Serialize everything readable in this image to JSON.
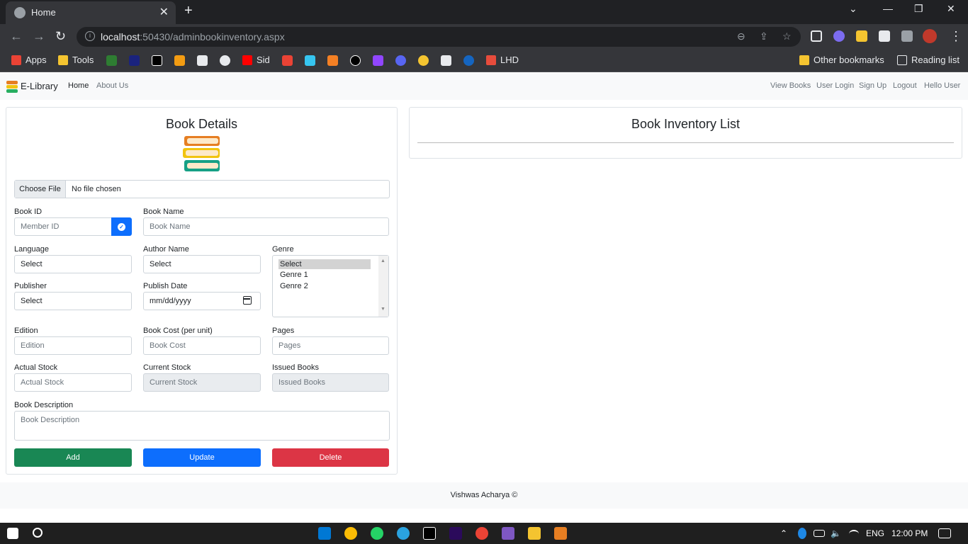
{
  "browser": {
    "tab_title": "Home",
    "url_host": "localhost",
    "url_rest": ":50430/adminbookinventory.aspx",
    "bookmarks": [
      "Apps",
      "Tools",
      "Sid",
      "LHD",
      "Other bookmarks",
      "Reading list"
    ]
  },
  "navbar": {
    "brand": "E-Library",
    "left_links": [
      "Home",
      "About Us"
    ],
    "right_links": [
      "View Books",
      "User Login",
      "Sign Up",
      "Logout",
      "Hello User"
    ]
  },
  "details": {
    "title": "Book Details",
    "file_button": "Choose File",
    "file_status": "No file chosen",
    "book_id_label": "Book ID",
    "book_id_placeholder": "Member ID",
    "book_name_label": "Book Name",
    "book_name_placeholder": "Book Name",
    "language_label": "Language",
    "language_value": "Select",
    "author_label": "Author Name",
    "author_value": "Select",
    "genre_label": "Genre",
    "genre_options": [
      "Select",
      "Genre 1",
      "Genre 2"
    ],
    "publisher_label": "Publisher",
    "publisher_value": "Select",
    "publish_date_label": "Publish Date",
    "publish_date_placeholder": "mm/dd/yyyy",
    "edition_label": "Edition",
    "edition_placeholder": "Edition",
    "cost_label": "Book Cost (per unit)",
    "cost_placeholder": "Book Cost",
    "pages_label": "Pages",
    "pages_placeholder": "Pages",
    "actual_stock_label": "Actual Stock",
    "actual_stock_placeholder": "Actual Stock",
    "current_stock_label": "Current Stock",
    "current_stock_placeholder": "Current Stock",
    "issued_label": "Issued Books",
    "issued_placeholder": "Issued Books",
    "description_label": "Book Description",
    "description_placeholder": "Book Description",
    "add_label": "Add",
    "update_label": "Update",
    "delete_label": "Delete"
  },
  "inventory": {
    "title": "Book Inventory List"
  },
  "footer": {
    "text": "Vishwas Acharya ©"
  },
  "taskbar": {
    "language": "ENG",
    "time": "12:00 PM"
  },
  "colors": {
    "add": "#198754",
    "update": "#0d6efd",
    "delete": "#dc3545"
  }
}
